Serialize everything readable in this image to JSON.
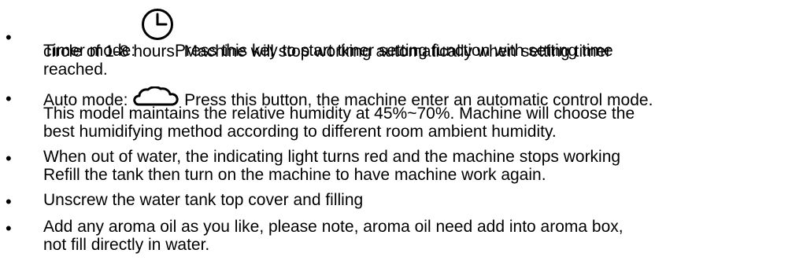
{
  "items": [
    {
      "lines": [
        "Timer mode:",
        "Press this key to start timer setting function with setting time",
        "circle of 1-8 hours. Machine will stop working automatically when setting timer",
        "reached."
      ],
      "icon": "clock-icon"
    },
    {
      "lines": [
        "Auto mode:",
        "Press this button, the machine enter an automatic control mode.",
        "This model maintains the relative humidity at 45%~70%. Machine will choose the",
        "best humidifying method according to different room ambient humidity."
      ],
      "icon": "cloud-icon"
    },
    {
      "lines": [
        "When out of water, the indicating light turns red and the machine stops working",
        "Refill the tank then turn on the machine to have machine work again."
      ]
    },
    {
      "lines": [
        "Unscrew the water tank top cover and filling"
      ]
    },
    {
      "lines": [
        "Add any aroma oil as you like,  please note, aroma oil need add into aroma box,",
        "not fill directly in water."
      ]
    }
  ]
}
